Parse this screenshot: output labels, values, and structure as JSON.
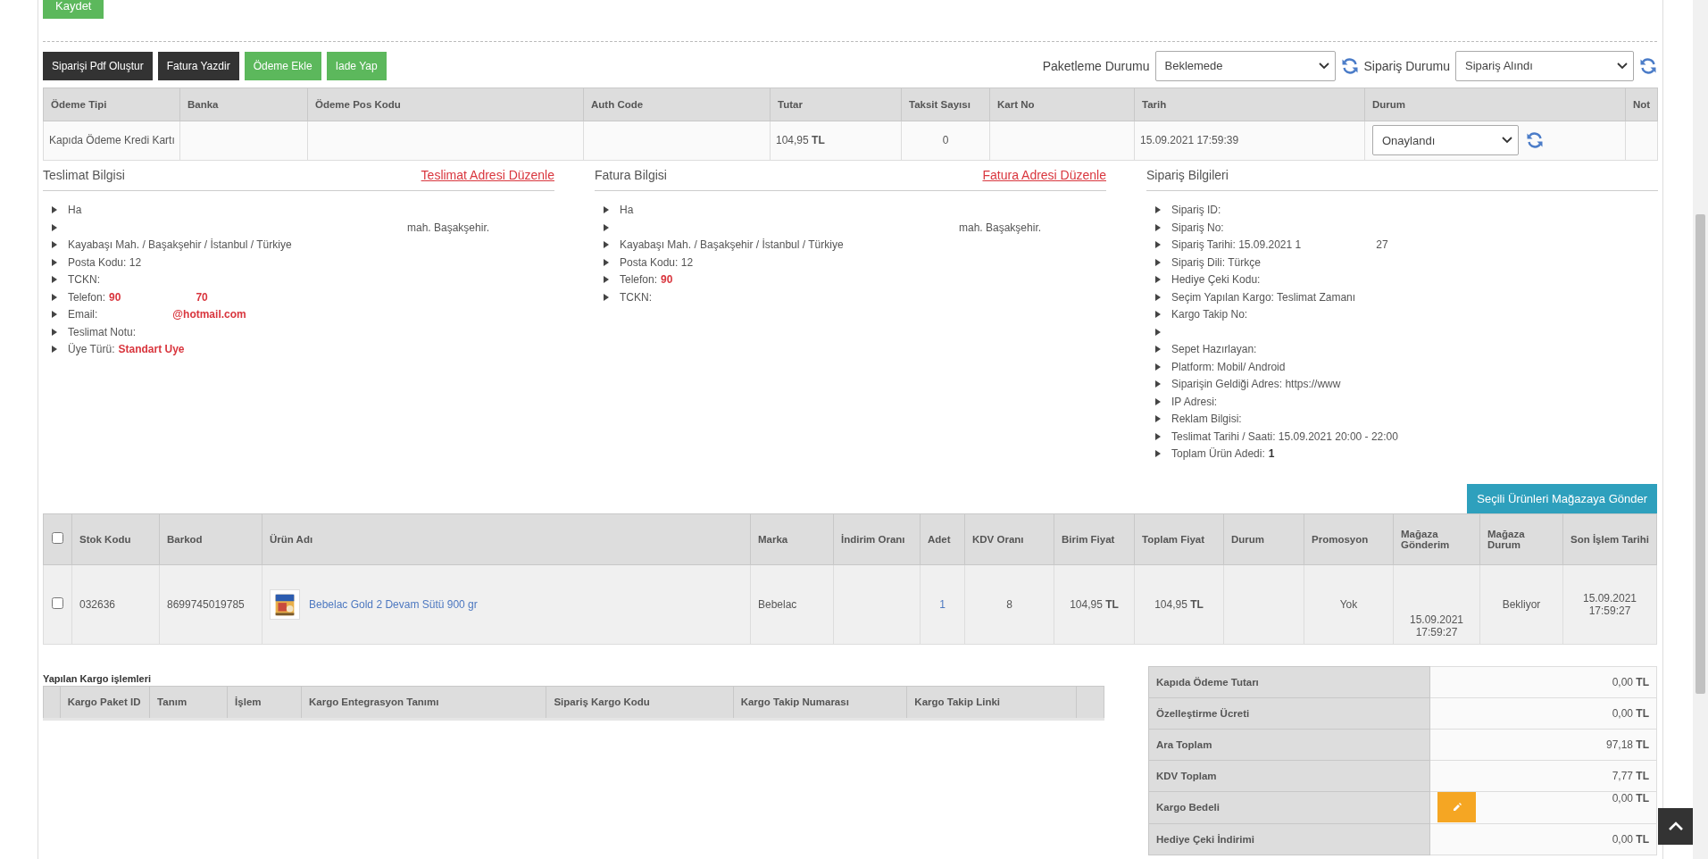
{
  "save_button": "Kaydet",
  "actions": [
    {
      "label": "Siparişi Pdf Oluştur",
      "kind": "dark"
    },
    {
      "label": "Fatura Yazdir",
      "kind": "dark"
    },
    {
      "label": "Ödeme Ekle",
      "kind": "green"
    },
    {
      "label": "Iade Yap",
      "kind": "green"
    }
  ],
  "status_selects": [
    {
      "label": "Paketleme Durumu",
      "value": "Beklemede"
    },
    {
      "label": "Sipariş Durumu",
      "value": "Sipariş Alındı"
    }
  ],
  "payments": {
    "columns": [
      "Ödeme Tipi",
      "Banka",
      "Ödeme Pos Kodu",
      "Auth Code",
      "Tutar",
      "Taksit Sayısı",
      "Kart No",
      "Tarih",
      "Durum",
      "Not"
    ],
    "rows": [
      {
        "cells": [
          {
            "kind": "text",
            "text": "Kapıda Ödeme Kredi Kartı"
          },
          {
            "kind": "empty"
          },
          {
            "kind": "empty"
          },
          {
            "kind": "empty"
          },
          {
            "kind": "text",
            "text": "104,95 **TL**"
          },
          {
            "kind": "center",
            "text": "0"
          },
          {
            "kind": "empty"
          },
          {
            "kind": "text",
            "text": "15.09.2021 17:59:39"
          },
          {
            "kind": "select",
            "text": "Onaylandı"
          },
          {
            "kind": "empty"
          }
        ]
      }
    ]
  },
  "info_sections": [
    {
      "title": "Teslimat Bilgisi",
      "link": "Teslimat Adresi Düzenle",
      "items": [
        {
          "kind": "text",
          "text": "Ha"
        },
        {
          "kind": "gap",
          "text": "mah. Başakşehir."
        },
        {
          "kind": "text",
          "text": "Kayabaşı Mah. / Başakşehir / İstanbul / Türkiye"
        },
        {
          "kind": "text",
          "text": "Posta Kodu: 12"
        },
        {
          "kind": "text",
          "text": "TCKN:"
        },
        {
          "kind": "text",
          "text": "Telefon:",
          "values": [
            "90",
            "70"
          ],
          "highlighted": true
        },
        {
          "kind": "text",
          "text": "Email:",
          "values": [
            "@hotmail.com"
          ],
          "highlighted": true,
          "lead_gap": true
        },
        {
          "kind": "text",
          "text": "Teslimat Notu:"
        },
        {
          "kind": "text",
          "text": "Üye Türü:",
          "values": [
            "Standart Uye"
          ],
          "highlighted": true
        }
      ]
    },
    {
      "title": "Fatura Bilgisi",
      "link": "Fatura Adresi Düzenle",
      "items": [
        {
          "kind": "text",
          "text": "Ha"
        },
        {
          "kind": "gap",
          "text": "mah. Başakşehir."
        },
        {
          "kind": "text",
          "text": "Kayabaşı Mah. / Başakşehir / İstanbul / Türkiye"
        },
        {
          "kind": "text",
          "text": "Posta Kodu: 12"
        },
        {
          "kind": "text",
          "text": "Telefon:",
          "values": [
            "90"
          ],
          "highlighted": true
        },
        {
          "kind": "text",
          "text": "TCKN:"
        }
      ]
    },
    {
      "title": "Sipariş Bilgileri",
      "items": [
        {
          "kind": "text",
          "text": "Sipariş ID:"
        },
        {
          "kind": "text",
          "text": "Sipariş No:"
        },
        {
          "kind": "text",
          "text": "Sipariş Tarihi: 15.09.2021 1",
          "values": [
            "27"
          ],
          "highlighted": false,
          "lead_gap": true
        },
        {
          "kind": "text",
          "text": "Sipariş Dili: Türkçe"
        },
        {
          "kind": "text",
          "text": "Hediye Çeki Kodu:"
        },
        {
          "kind": "text",
          "text": "Seçim Yapılan Kargo: Teslimat Zamanı"
        },
        {
          "kind": "text",
          "text": "Kargo Takip No:"
        },
        {
          "kind": "blank"
        },
        {
          "kind": "text",
          "text": "Sepet Hazırlayan:"
        },
        {
          "kind": "text",
          "text": "Platform: Mobil/ Android"
        },
        {
          "kind": "text",
          "text": "Siparişin Geldiği Adres: https://www"
        },
        {
          "kind": "text",
          "text": "IP Adresi:"
        },
        {
          "kind": "text",
          "text": "Reklam Bilgisi:"
        },
        {
          "kind": "text",
          "text": "Teslimat Tarihi / Saati: 15.09.2021 20:00 - 22:00"
        },
        {
          "kind": "text",
          "text": "Toplam Ürün Adedi:",
          "values": [
            "1"
          ],
          "highlighted": false,
          "bold": true
        }
      ]
    }
  ],
  "send_button": "Seçili Ürünleri Mağazaya Gönder",
  "products": {
    "select_all": {
      "checked": false
    },
    "columns": [
      "Stok Kodu",
      "Barkod",
      "Ürün Adı",
      "Marka",
      "İndirim Oranı",
      "Adet",
      "KDV Oranı",
      "Birim Fiyat",
      "Toplam Fiyat",
      "Durum",
      "Promosyon",
      "Mağaza Gönderim",
      "Mağaza Durum",
      "Son İşlem Tarihi"
    ],
    "rows": [
      {
        "checked": false,
        "cells": [
          {
            "kind": "text",
            "text": "032636"
          },
          {
            "kind": "text",
            "text": "8699745019785"
          },
          {
            "kind": "product",
            "text": "Bebelac Gold 2 Devam Sütü 900 gr"
          },
          {
            "kind": "text",
            "text": "Bebelac"
          },
          {
            "kind": "empty"
          },
          {
            "kind": "link",
            "text": "1"
          },
          {
            "kind": "center",
            "text": "8"
          },
          {
            "kind": "center",
            "text": "104,95 **TL**"
          },
          {
            "kind": "center",
            "text": "104,95 **TL**"
          },
          {
            "kind": "empty"
          },
          {
            "kind": "center",
            "text": "Yok"
          },
          {
            "kind": "store",
            "text": "15.09.2021 17:59:27"
          },
          {
            "kind": "center",
            "text": "Bekliyor"
          },
          {
            "kind": "center",
            "text": "15.09.2021 17:59:27"
          }
        ]
      }
    ]
  },
  "cargo": {
    "title": "Yapılan Kargo işlemleri",
    "columns": [
      "Kargo Paket ID",
      "Tanım",
      "İşlem",
      "Kargo Entegrasyon Tanımı",
      "Sipariş Kargo Kodu",
      "Kargo Takip Numarası",
      "Kargo Takip Linki"
    ]
  },
  "summary": [
    {
      "label": "Kapıda Ödeme Tutarı",
      "value": "0,00 **TL**",
      "editable": false
    },
    {
      "label": "Özelleştirme Ücreti",
      "value": "0,00 **TL**",
      "editable": false
    },
    {
      "label": "Ara Toplam",
      "value": "97,18 **TL**",
      "editable": false
    },
    {
      "label": "KDV Toplam",
      "value": "7,77 **TL**",
      "editable": false
    },
    {
      "label": "Kargo Bedeli",
      "value": "0,00 **TL**",
      "editable": true
    },
    {
      "label": "Hediye Çeki İndirimi",
      "value": "0,00 **TL**",
      "editable": false
    }
  ]
}
